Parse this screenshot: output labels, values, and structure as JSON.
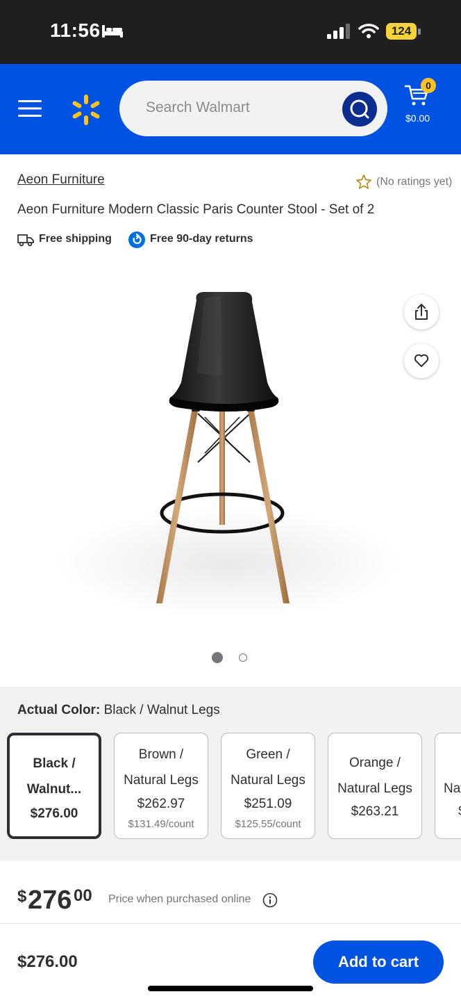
{
  "status_bar": {
    "time": "11:56",
    "battery": "124"
  },
  "header": {
    "search_placeholder": "Search Walmart",
    "cart_count": "0",
    "cart_total": "$0.00",
    "accent": "#0053e2",
    "spark_color": "#ffc220"
  },
  "product": {
    "brand": "Aeon Furniture",
    "rating_text": "(No ratings yet)",
    "title": "Aeon Furniture Modern Classic Paris Counter Stool - Set of 2",
    "shipping": "Free shipping",
    "returns": "Free 90-day returns"
  },
  "gallery": {
    "image_count": 2,
    "current_index": 1
  },
  "variants": {
    "label": "Actual Color:",
    "selected": "Black / Walnut Legs",
    "options": [
      {
        "line1": "Black /",
        "line2": "Walnut...",
        "price": "$276.00",
        "unit": "",
        "selected": true
      },
      {
        "line1": "Brown /",
        "line2": "Natural Legs",
        "price": "$262.97",
        "unit": "$131.49/count",
        "selected": false
      },
      {
        "line1": "Green /",
        "line2": "Natural Legs",
        "price": "$251.09",
        "unit": "$125.55/count",
        "selected": false
      },
      {
        "line1": "Orange /",
        "line2": "Natural Legs",
        "price": "$263.21",
        "unit": "",
        "selected": false
      },
      {
        "line1": "",
        "line2": "Nat",
        "price": "$",
        "unit": "",
        "selected": false
      }
    ]
  },
  "price": {
    "currency": "$",
    "whole": "276",
    "cents": "00",
    "note": "Price when purchased online"
  },
  "bottom_bar": {
    "price": "$276.00",
    "add_to_cart": "Add to cart"
  }
}
